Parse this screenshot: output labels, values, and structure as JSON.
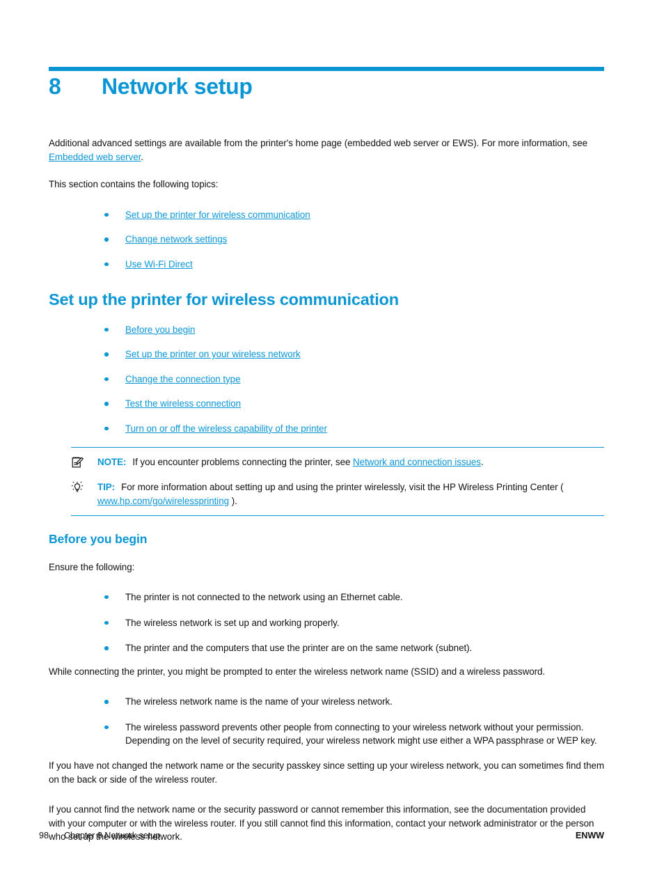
{
  "chapter": {
    "number": "8",
    "title": "Network setup"
  },
  "intro": {
    "para1_before": "Additional advanced settings are available from the printer's home page (embedded web server or EWS). For more information, see ",
    "para1_link": "Embedded web server",
    "para1_after": ".",
    "para2": "This section contains the following topics:"
  },
  "topics": [
    {
      "label": "Set up the printer for wireless communication"
    },
    {
      "label": "Change network settings"
    },
    {
      "label": "Use Wi-Fi Direct"
    }
  ],
  "section": {
    "heading": "Set up the printer for wireless communication",
    "subtopics": [
      {
        "label": "Before you begin"
      },
      {
        "label": "Set up the printer on your wireless network"
      },
      {
        "label": "Change the connection type"
      },
      {
        "label": "Test the wireless connection"
      },
      {
        "label": "Turn on or off the wireless capability of the printer"
      }
    ]
  },
  "callouts": {
    "note": {
      "icon": "note-pad-icon",
      "label": "NOTE:",
      "text_before": "If you encounter problems connecting the printer, see ",
      "link": "Network and connection issues",
      "text_after": "."
    },
    "tip": {
      "icon": "lightbulb-icon",
      "label": "TIP:",
      "text_before": "For more information about setting up and using the printer wirelessly, visit the HP Wireless Printing Center ( ",
      "link": "www.hp.com/go/wirelessprinting",
      "text_after": " )."
    }
  },
  "before_you_begin": {
    "heading": "Before you begin",
    "lead": "Ensure the following:",
    "checklist": [
      {
        "label": "The printer is not connected to the network using an Ethernet cable."
      },
      {
        "label": "The wireless network is set up and working properly."
      },
      {
        "label": "The printer and the computers that use the printer are on the same network (subnet)."
      }
    ],
    "para_prompt": "While connecting the printer, you might be prompted to enter the wireless network name (SSID) and a wireless password.",
    "details": [
      {
        "label": "The wireless network name is the name of your wireless network."
      },
      {
        "label": "The wireless password prevents other people from connecting to your wireless network without your permission. Depending on the level of security required, your wireless network might use either a WPA passphrase or WEP key."
      }
    ],
    "para_router": "If you have not changed the network name or the security passkey since setting up your wireless network, you can sometimes find them on the back or side of the wireless router.",
    "para_cannot_find": "If you cannot find the network name or the security password or cannot remember this information, see the documentation provided with your computer or with the wireless router. If you still cannot find this information, contact your network administrator or the person who set up the wireless network."
  },
  "footer": {
    "page_number": "98",
    "chapter_label": "Chapter 8  Network setup",
    "locale": "ENWW"
  },
  "colors": {
    "accent": "#0a96d4",
    "text": "#111111"
  }
}
